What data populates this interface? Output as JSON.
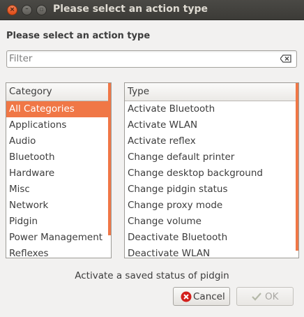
{
  "window": {
    "title": "Please select an action type"
  },
  "heading": "Please select an action type",
  "filter": {
    "placeholder": "Filter",
    "value": ""
  },
  "category": {
    "header": "Category",
    "items": [
      "All Categories",
      "Applications",
      "Audio",
      "Bluetooth",
      "Hardware",
      "Misc",
      "Network",
      "Pidgin",
      "Power Management",
      "Reflexes"
    ],
    "selected": "All Categories"
  },
  "type": {
    "header": "Type",
    "items": [
      "Activate Bluetooth",
      "Activate WLAN",
      "Activate reflex",
      "Change default printer",
      "Change desktop background",
      "Change pidgin status",
      "Change proxy mode",
      "Change volume",
      "Deactivate Bluetooth",
      "Deactivate WLAN"
    ]
  },
  "status": "Activate a saved status of pidgin",
  "buttons": {
    "cancel": "Cancel",
    "ok": "OK"
  },
  "colors": {
    "accent": "#f07746",
    "titlebar": "#3c3b37",
    "dialog_bg": "#f2f1f0",
    "close": "#df4b16"
  },
  "icons": {
    "clear": "clear-icon",
    "cancel": "cancel-icon",
    "ok": "check-icon"
  }
}
